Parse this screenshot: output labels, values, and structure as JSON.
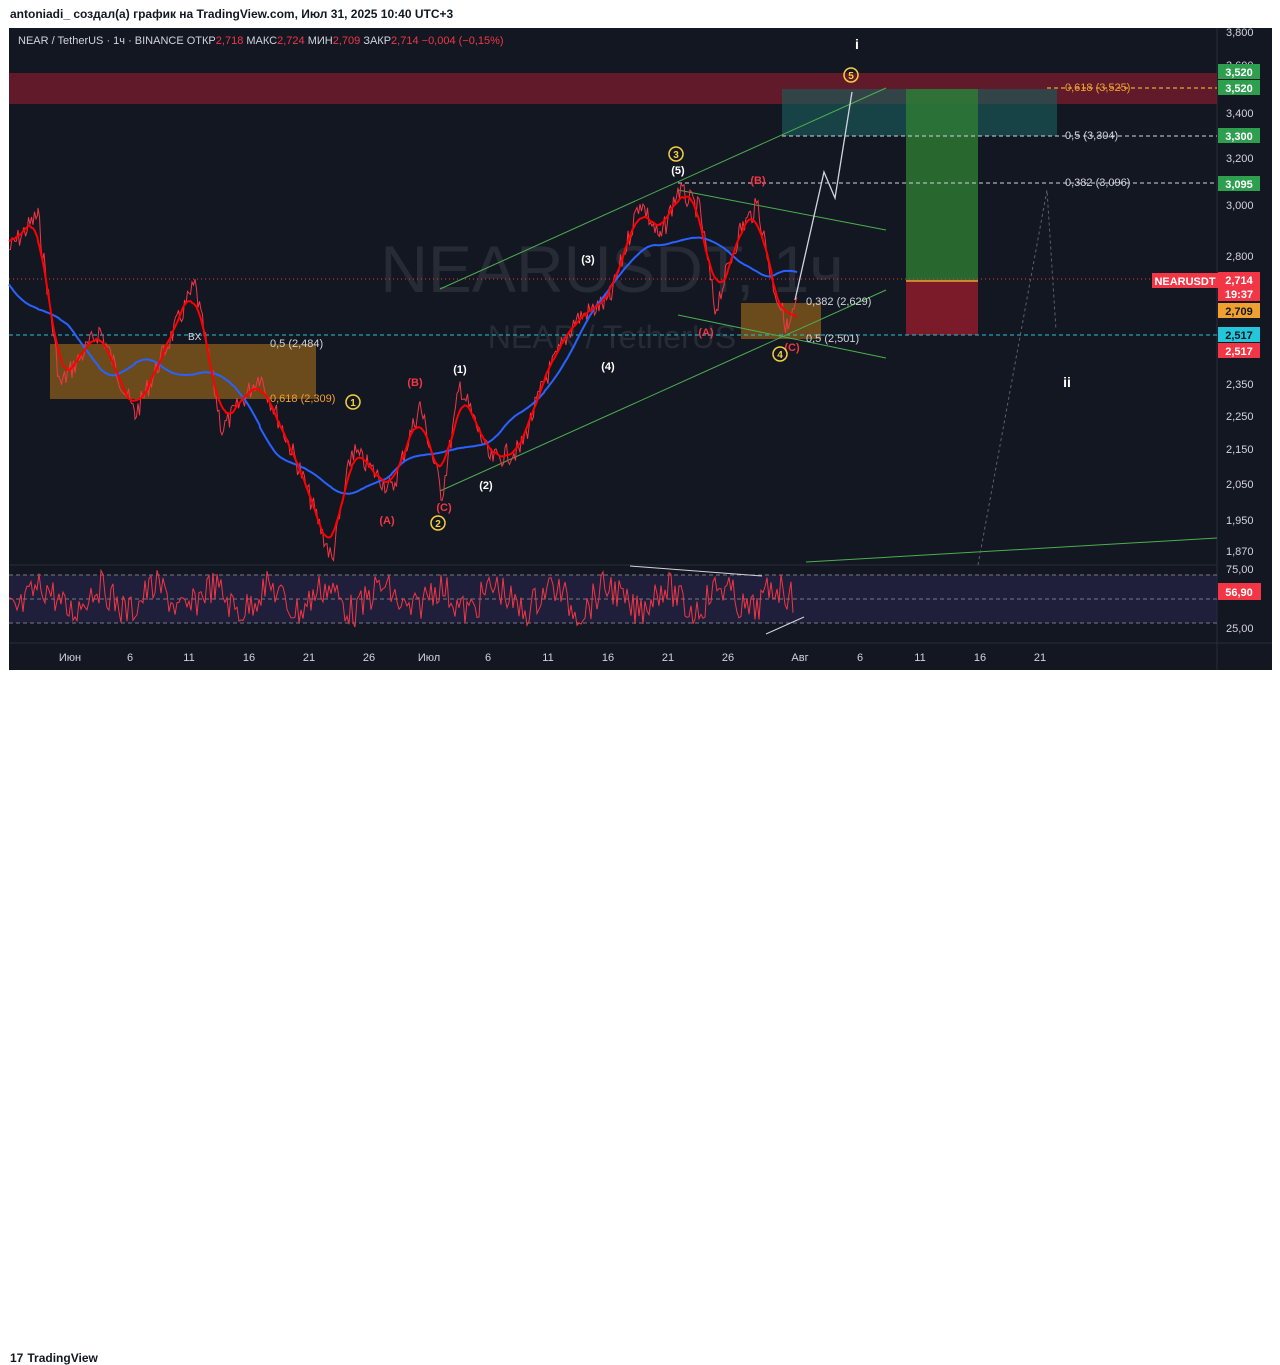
{
  "header": {
    "attribution": "antoniadi_ создал(а) график на TradingView.com, Июл 31, 2025 10:40 UTC+3"
  },
  "legend": {
    "symbol": "NEAR / TetherUS · 1ч · BINANCE",
    "open_label": "ОТКР",
    "open": "2,718",
    "high_label": "МАКС",
    "high": "2,724",
    "low_label": "МИН",
    "low": "2,709",
    "close_label": "ЗАКР",
    "close": "2,714",
    "change": "−0,004 (−0,15%)"
  },
  "watermark": {
    "main": "NEARUSDT, 1ч",
    "sub": "NEAR / TetherUS"
  },
  "footer": {
    "brand": "TradingView",
    "brand_mark": "17"
  },
  "colors": {
    "background": "#131722",
    "price_line": "#f23645",
    "ma_blue": "#2962ff",
    "ma_red": "#ff0000",
    "resistance_zone": "#6e1b2a",
    "support_zone": "#8a5e1a",
    "take_profit": "#2e7d32",
    "stop_loss": "#8e1c2c",
    "wave_yellow": "#f5d142",
    "channel_green": "#4caf50"
  },
  "chart_data": {
    "type": "candlestick",
    "title": "NEAR / TetherUS · 1ч · BINANCE",
    "y_axis_ticks": [
      "3,800",
      "3,600",
      "3,400",
      "3,200",
      "3,000",
      "2,800",
      "2,350",
      "2,250",
      "2,150",
      "2,050",
      "1,950",
      "1,870"
    ],
    "x_axis_ticks": [
      "Июн",
      "6",
      "11",
      "16",
      "21",
      "26",
      "Июл",
      "6",
      "11",
      "16",
      "21",
      "26",
      "Авг",
      "6",
      "11",
      "16",
      "21"
    ],
    "price_labels": [
      {
        "text": "3,520",
        "kind": "green"
      },
      {
        "text": "3,520",
        "kind": "green"
      },
      {
        "text": "3,300",
        "kind": "green"
      },
      {
        "text": "3,095",
        "kind": "green"
      },
      {
        "text": "NEARUSDT",
        "kind": "red"
      },
      {
        "text": "2,714",
        "kind": "red"
      },
      {
        "text": "19:37",
        "kind": "red"
      },
      {
        "text": "2,709",
        "kind": "orange"
      },
      {
        "text": "2,517",
        "kind": "cyan"
      },
      {
        "text": "2,517",
        "kind": "red"
      }
    ],
    "fib_levels": [
      {
        "label": "0,618 (3,525)"
      },
      {
        "label": "0,5 (3,304)"
      },
      {
        "label": "0,382 (3,096)"
      },
      {
        "label": "0,382 (2,629)"
      },
      {
        "label": "0,5 (2,501)"
      },
      {
        "label": "0,5 (2,484)"
      },
      {
        "label": "0,618 (2,309)"
      }
    ],
    "wave_labels": [
      "i",
      "ii",
      "(1)",
      "(2)",
      "(3)",
      "(4)",
      "(5)",
      "(A)",
      "(B)",
      "(C)",
      "(A)",
      "(B)",
      "(C)",
      "(A)",
      "(B)",
      "(C)",
      "1",
      "2",
      "3",
      "4",
      "5"
    ],
    "rsi": {
      "ticks": [
        "75,00",
        "25,00"
      ],
      "value": "56,90"
    },
    "other_labels": [
      "BX"
    ]
  }
}
